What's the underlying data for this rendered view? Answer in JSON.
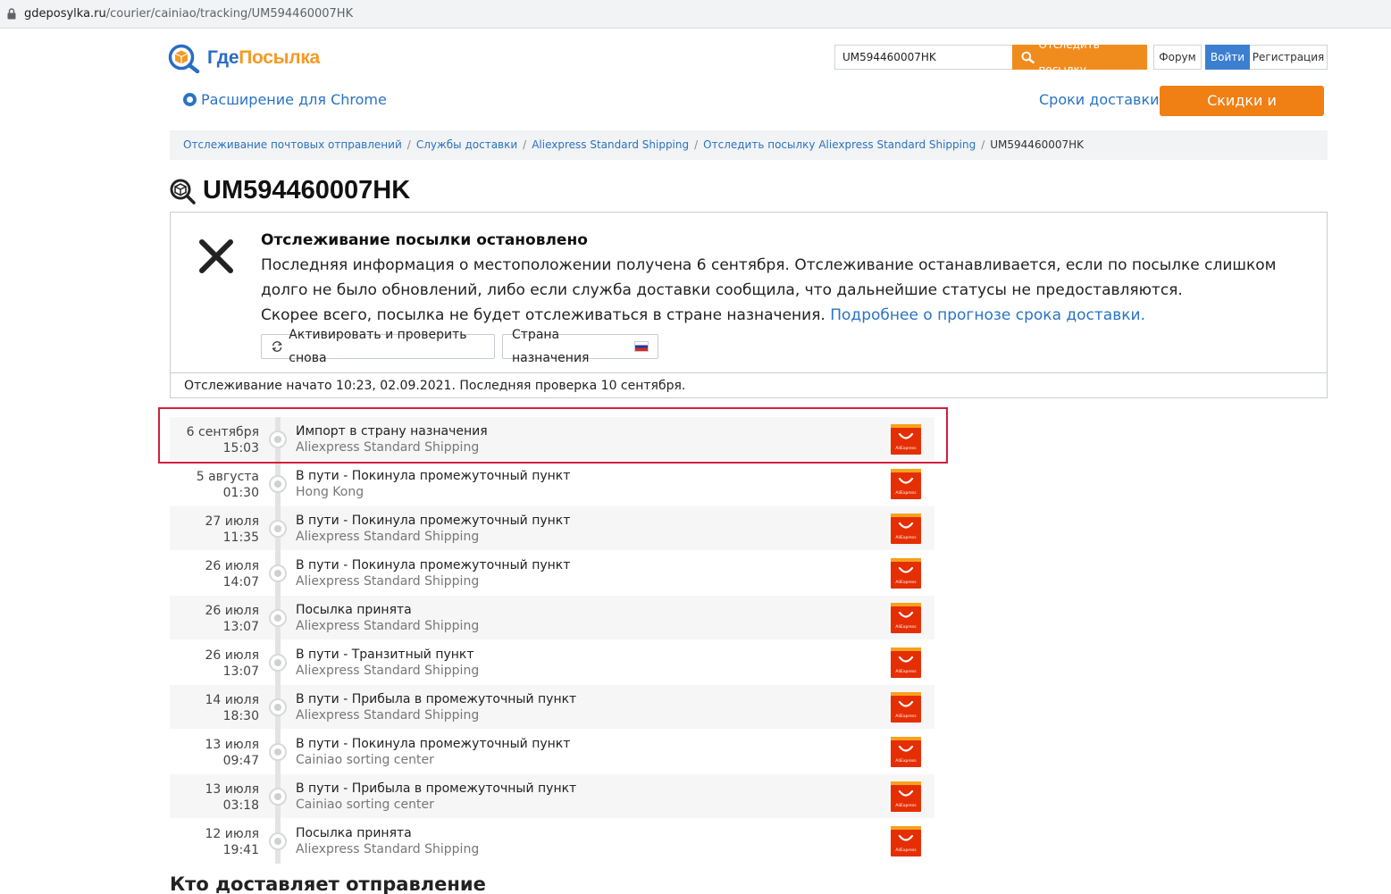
{
  "browser": {
    "url_host": "gdeposylka.ru",
    "url_path": "/courier/cainiao/tracking/UM594460007HK"
  },
  "header": {
    "logo_part1": "Где",
    "logo_part2": "Посылка",
    "search_value": "UM594460007HK",
    "track_button": "Отследить посылку",
    "forum_button": "Форум",
    "login_button": "Войти",
    "register_button": "Регистрация",
    "chrome_extension": "Расширение для Chrome",
    "delivery_terms": "Сроки доставки",
    "promo_button": "Скидки и промокоды!"
  },
  "breadcrumb": {
    "items": [
      "Отслеживание почтовых отправлений",
      "Службы доставки",
      "Aliexpress Standard Shipping",
      "Отследить посылку Aliexpress Standard Shipping"
    ],
    "current": "UM594460007HK"
  },
  "page_title": "UM594460007HK",
  "status_panel": {
    "title": "Отслеживание посылки остановлено",
    "line1": "Последняя информация о местоположении получена 6 сентября. Отслеживание останавливается, если по посылке слишком долго не было обновлений, либо если служба доставки сообщила, что дальнейшие статусы не предоставляются.",
    "line2": "Скорее всего, посылка не будет отслеживаться в стране назначения.",
    "more_link": "Подробнее о прогнозе срока доставки.",
    "activate_button": "Активировать и проверить снова",
    "country_button": "Страна назначения",
    "footer": "Отслеживание начато 10:23, 02.09.2021. Последняя проверка 10 сентября."
  },
  "courier_logo_text": "AliExpress",
  "events": [
    {
      "date": "6 сентября",
      "time": "15:03",
      "status": "Импорт в страну назначения",
      "place": "Aliexpress Standard Shipping"
    },
    {
      "date": "5 августа",
      "time": "01:30",
      "status": "В пути - Покинула промежуточный пункт",
      "place": "Hong Kong"
    },
    {
      "date": "27 июля",
      "time": "11:35",
      "status": "В пути - Покинула промежуточный пункт",
      "place": "Aliexpress Standard Shipping"
    },
    {
      "date": "26 июля",
      "time": "14:07",
      "status": "В пути - Покинула промежуточный пункт",
      "place": "Aliexpress Standard Shipping"
    },
    {
      "date": "26 июля",
      "time": "13:07",
      "status": "Посылка принята",
      "place": "Aliexpress Standard Shipping"
    },
    {
      "date": "26 июля",
      "time": "13:07",
      "status": "В пути - Транзитный пункт",
      "place": "Aliexpress Standard Shipping"
    },
    {
      "date": "14 июля",
      "time": "18:30",
      "status": "В пути - Прибыла в промежуточный пункт",
      "place": "Aliexpress Standard Shipping"
    },
    {
      "date": "13 июля",
      "time": "09:47",
      "status": "В пути - Покинула промежуточный пункт",
      "place": "Cainiao sorting center"
    },
    {
      "date": "13 июля",
      "time": "03:18",
      "status": "В пути - Прибыла в промежуточный пункт",
      "place": "Cainiao sorting center"
    },
    {
      "date": "12 июля",
      "time": "19:41",
      "status": "Посылка принята",
      "place": "Aliexpress Standard Shipping"
    }
  ],
  "who_delivers_heading": "Кто доставляет отправление",
  "colors": {
    "brand_blue": "#2a6cc4",
    "brand_orange": "#f59a23",
    "link": "#2a73c3",
    "promo": "#f07f14",
    "highlight": "#d21f3c",
    "aliexpress": "#e62e04"
  }
}
